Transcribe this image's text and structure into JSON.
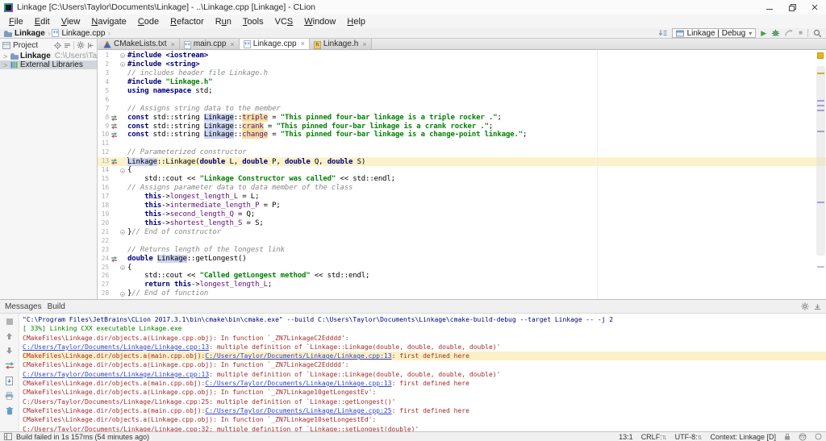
{
  "window": {
    "title": "Linkage [C:\\Users\\Taylor\\Documents\\Linkage] - ..\\Linkage.cpp [Linkage] - CLion"
  },
  "menu": {
    "items": [
      {
        "label": "File",
        "u": 0
      },
      {
        "label": "Edit",
        "u": 0
      },
      {
        "label": "View",
        "u": 0
      },
      {
        "label": "Navigate",
        "u": 0
      },
      {
        "label": "Code",
        "u": 0
      },
      {
        "label": "Refactor",
        "u": 0
      },
      {
        "label": "Run",
        "u": 1
      },
      {
        "label": "Tools",
        "u": 0
      },
      {
        "label": "VCS",
        "u": 2
      },
      {
        "label": "Window",
        "u": 0
      },
      {
        "label": "Help",
        "u": 0
      }
    ]
  },
  "breadcrumbs": {
    "items": [
      {
        "label": "Linkage",
        "icon": "folder"
      },
      {
        "label": "Linkage.cpp",
        "icon": "cpp"
      }
    ]
  },
  "run": {
    "config": "Linkage | Debug"
  },
  "project": {
    "header": "Project",
    "items": [
      {
        "icon": "folder",
        "label": "Linkage",
        "path": "C:\\Users\\Taylor\\Do",
        "selected": false
      },
      {
        "icon": "lib",
        "label": "External Libraries",
        "path": "",
        "selected": true
      }
    ]
  },
  "tabs": [
    {
      "label": "CMakeLists.txt",
      "icon": "cmake",
      "active": false
    },
    {
      "label": "main.cpp",
      "icon": "cpp",
      "active": false
    },
    {
      "label": "Linkage.cpp",
      "icon": "cpp",
      "active": true
    },
    {
      "label": "Linkage.h",
      "icon": "h",
      "active": false
    }
  ],
  "editor": {
    "lines": [
      {
        "n": 1,
        "fold": true,
        "segs": [
          [
            "#include ",
            "k"
          ],
          [
            "<iostream>",
            "k"
          ]
        ]
      },
      {
        "n": 2,
        "fold": true,
        "segs": [
          [
            "#include ",
            "k"
          ],
          [
            "<string>",
            "k"
          ]
        ]
      },
      {
        "n": 3,
        "segs": [
          [
            "// includes header file Linkage.h",
            "c"
          ]
        ]
      },
      {
        "n": 4,
        "segs": [
          [
            "#include ",
            "k"
          ],
          [
            "\"Linkage.h\"",
            "s"
          ]
        ]
      },
      {
        "n": 5,
        "segs": [
          [
            "using namespace ",
            "k"
          ],
          [
            "std;",
            "p"
          ]
        ]
      },
      {
        "n": 6,
        "segs": []
      },
      {
        "n": 7,
        "segs": [
          [
            "// Assigns string data to the member",
            "c"
          ]
        ]
      },
      {
        "n": 8,
        "icon": true,
        "segs": [
          [
            "const ",
            "k"
          ],
          [
            "std::string ",
            "p"
          ],
          [
            "Linkage",
            "hlb"
          ],
          [
            "::",
            "p"
          ],
          [
            "triple",
            "fy"
          ],
          [
            " = ",
            "p"
          ],
          [
            "\"This pinned four-bar linkage is a triple rocker .\"",
            "s"
          ],
          [
            ";",
            "p"
          ]
        ]
      },
      {
        "n": 9,
        "icon": true,
        "segs": [
          [
            "const ",
            "k"
          ],
          [
            "std::string ",
            "p"
          ],
          [
            "Linkage",
            "hlb"
          ],
          [
            "::",
            "p"
          ],
          [
            "crank",
            "fy"
          ],
          [
            " = ",
            "p"
          ],
          [
            "\"This pinned four-bar linkage is a crank rocker .\"",
            "s"
          ],
          [
            ";",
            "p"
          ]
        ]
      },
      {
        "n": 10,
        "icon": true,
        "segs": [
          [
            "const ",
            "k"
          ],
          [
            "std::string ",
            "p"
          ],
          [
            "Linkage",
            "hlb"
          ],
          [
            "::",
            "p"
          ],
          [
            "change",
            "fy"
          ],
          [
            " = ",
            "p"
          ],
          [
            "\"This pinned four-bar linkage is a change-point linkage.\"",
            "s"
          ],
          [
            ";",
            "p"
          ]
        ]
      },
      {
        "n": 11,
        "segs": []
      },
      {
        "n": 12,
        "segs": [
          [
            "// Parameterized constructor",
            "c"
          ]
        ]
      },
      {
        "n": 13,
        "icon": true,
        "caret": true,
        "segs": [
          [
            "Linkage",
            "hlb"
          ],
          [
            "::Linkage(",
            "p"
          ],
          [
            "double",
            "k"
          ],
          [
            " L, ",
            "p"
          ],
          [
            "double",
            "k"
          ],
          [
            " P, ",
            "p"
          ],
          [
            "double",
            "k"
          ],
          [
            " Q, ",
            "p"
          ],
          [
            "double",
            "k"
          ],
          [
            " S)",
            "p"
          ]
        ]
      },
      {
        "n": 14,
        "fold": true,
        "segs": [
          [
            "{",
            "p"
          ]
        ]
      },
      {
        "n": 15,
        "segs": [
          [
            "    std::cout << ",
            "p"
          ],
          [
            "\"Linkage Constructor was called\"",
            "s"
          ],
          [
            " << std::endl;",
            "p"
          ]
        ]
      },
      {
        "n": 16,
        "segs": [
          [
            "// Assigns parameter data to data member of the class",
            "c"
          ]
        ]
      },
      {
        "n": 17,
        "segs": [
          [
            "    ",
            "p"
          ],
          [
            "this",
            "k"
          ],
          [
            "->",
            "p"
          ],
          [
            "longest_length_L",
            "f"
          ],
          [
            " = L;",
            "p"
          ]
        ]
      },
      {
        "n": 18,
        "segs": [
          [
            "    ",
            "p"
          ],
          [
            "this",
            "k"
          ],
          [
            "->",
            "p"
          ],
          [
            "intermediate_length_P",
            "f"
          ],
          [
            " = P;",
            "p"
          ]
        ]
      },
      {
        "n": 19,
        "segs": [
          [
            "    ",
            "p"
          ],
          [
            "this",
            "k"
          ],
          [
            "->",
            "p"
          ],
          [
            "second_length_Q",
            "f"
          ],
          [
            " = Q;",
            "p"
          ]
        ]
      },
      {
        "n": 20,
        "segs": [
          [
            "    ",
            "p"
          ],
          [
            "this",
            "k"
          ],
          [
            "->",
            "p"
          ],
          [
            "shortest_length_S",
            "f"
          ],
          [
            " = S;",
            "p"
          ]
        ]
      },
      {
        "n": 21,
        "fold": true,
        "segs": [
          [
            "}",
            "p"
          ],
          [
            "// End of constructor",
            "c"
          ]
        ]
      },
      {
        "n": 22,
        "segs": []
      },
      {
        "n": 23,
        "segs": [
          [
            "// Returns length of the longest link",
            "c"
          ]
        ]
      },
      {
        "n": 24,
        "icon": true,
        "segs": [
          [
            "double ",
            "k"
          ],
          [
            "Linkage",
            "hlb"
          ],
          [
            "::getLongest()",
            "p"
          ]
        ]
      },
      {
        "n": 25,
        "fold": true,
        "segs": [
          [
            "{",
            "p"
          ]
        ]
      },
      {
        "n": 26,
        "segs": [
          [
            "    std::cout << ",
            "p"
          ],
          [
            "\"Called getLongest method\"",
            "s"
          ],
          [
            " << std::endl;",
            "p"
          ]
        ]
      },
      {
        "n": 27,
        "segs": [
          [
            "    ",
            "p"
          ],
          [
            "return this",
            "k"
          ],
          [
            "->",
            "p"
          ],
          [
            "longest_length_L",
            "f"
          ],
          [
            ";",
            "p"
          ]
        ]
      },
      {
        "n": 28,
        "fold": true,
        "segs": [
          [
            "}",
            "p"
          ],
          [
            "// End of function",
            "c"
          ]
        ]
      }
    ]
  },
  "messages": {
    "title": "Messages",
    "tab": "Build",
    "lines": [
      {
        "segs": [
          [
            "\"C:\\Program Files\\JetBrains\\CLion 2017.3.1\\bin\\cmake\\bin\\cmake.exe\" --build C:\\Users\\Taylor\\Documents\\Linkage\\cmake-build-debug --target Linkage -- -j 2",
            "nvy"
          ]
        ]
      },
      {
        "segs": [
          [
            "[ 33%] Linking CXX executable Linkage.exe",
            "grn"
          ]
        ]
      },
      {
        "segs": [
          [
            "CMakeFiles\\Linkage.dir/objects.a(Linkage.cpp.obj): In function `_ZN7LinkageC2Edddd':",
            "red"
          ]
        ]
      },
      {
        "segs": [
          [
            "C:/Users/Taylor/Documents/Linkage/Linkage.cpp:13",
            "lnk"
          ],
          [
            ": multiple definition of `Linkage::Linkage(double, double, double, double)'",
            "red"
          ]
        ]
      },
      {
        "hl": true,
        "segs": [
          [
            "CMakeFiles\\Linkage.dir/objects.a(main.cpp.obj):",
            "red"
          ],
          [
            "C:/Users/Taylor/Documents/Linkage/Linkage.cpp:13",
            "lnk"
          ],
          [
            ": first defined here",
            "red"
          ]
        ]
      },
      {
        "segs": [
          [
            "CMakeFiles\\Linkage.dir/objects.a(Linkage.cpp.obj): In function `_ZN7LinkageC2Edddd':",
            "red"
          ]
        ]
      },
      {
        "segs": [
          [
            "C:/Users/Taylor/Documents/Linkage/Linkage.cpp:13",
            "lnk"
          ],
          [
            ": multiple definition of `Linkage::Linkage(double, double, double, double)'",
            "red"
          ]
        ]
      },
      {
        "segs": [
          [
            "CMakeFiles\\Linkage.dir/objects.a(main.cpp.obj):",
            "red"
          ],
          [
            "C:/Users/Taylor/Documents/Linkage/Linkage.cpp:13",
            "lnk"
          ],
          [
            ": first defined here",
            "red"
          ]
        ]
      },
      {
        "segs": [
          [
            "CMakeFiles\\Linkage.dir/objects.a(Linkage.cpp.obj): In function `_ZN7Linkage10getLongestEv':",
            "red"
          ]
        ]
      },
      {
        "segs": [
          [
            "C:/Users/Taylor/Documents/Linkage/Linkage.cpp:25: multiple definition of `Linkage::getLongest()'",
            "red"
          ]
        ]
      },
      {
        "segs": [
          [
            "CMakeFiles\\Linkage.dir/objects.a(main.cpp.obj):",
            "red"
          ],
          [
            "C:/Users/Taylor/Documents/Linkage/Linkage.cpp:25",
            "lnk"
          ],
          [
            ": first defined here",
            "red"
          ]
        ]
      },
      {
        "segs": [
          [
            "CMakeFiles\\Linkage.dir/objects.a(Linkage.cpp.obj): In function `_ZN7Linkage10setLongestEd':",
            "red"
          ]
        ]
      },
      {
        "segs": [
          [
            "C:/Users/Taylor/Documents/Linkage/Linkage.cpp:32: multiple definition of `Linkage::setLongest(double)'",
            "red"
          ]
        ]
      }
    ]
  },
  "status": {
    "left": "Build failed in 1s 157ms (54 minutes ago)",
    "caret_pos": "13:1",
    "line_ending": "CRLF:",
    "encoding": "UTF-8:",
    "context": "Context: Linkage [D]"
  },
  "colors": {
    "keyword": "#000080",
    "string": "#008000",
    "comment": "#8a8a8a",
    "field": "#660e7a",
    "error_text": "#a52a2a",
    "link": "#3344cc",
    "caret_row": "#fbf2cc",
    "run_green": "#3fa33f",
    "warning_stripe": "#e8b416"
  }
}
